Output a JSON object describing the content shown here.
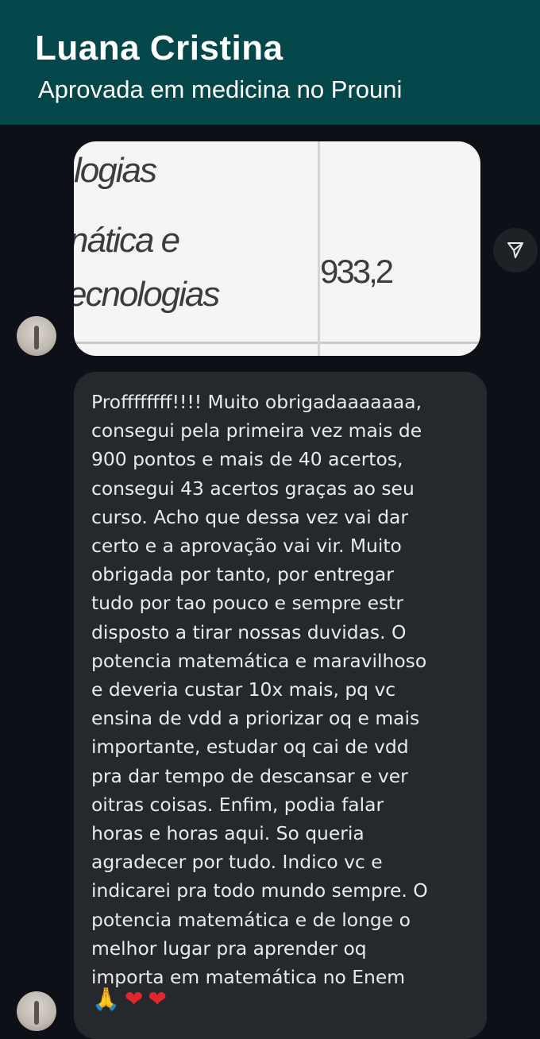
{
  "header": {
    "name": "Luana Cristina",
    "subtitle": "Aprovada em medicina no Prouni"
  },
  "image_message": {
    "cells": {
      "row1_left": "logias",
      "row2_left_line1": "nática e",
      "row2_left_line2": "ecnologias",
      "score": "933,2"
    }
  },
  "message": {
    "text": "Proffffffff!!!! Muito obrigadaaaaaaa,\nconsegui pela primeira vez mais de\n900 pontos e mais de 40 acertos,\nconsegui 43 acertos graças ao seu\ncurso. Acho que dessa vez vai dar\ncerto e a aprovação vai vir. Muito\nobrigada por tanto, por entregar\ntudo por tao pouco e sempre estr\ndisposto a tirar nossas duvidas. O\npotencia matemática e maravilhoso\ne deveria custar 10x mais, pq vc\nensina de vdd a priorizar oq e mais\nimportante, estudar oq cai de vdd\npra dar tempo de descansar e ver\noitras coisas. Enfim, podia falar\nhoras e horas aqui. So queria\nagradecer por tudo. Indico vc e\nindicarei pra todo mundo sempre. O\npotencia matemática e de longe o\nmelhor lugar pra aprender oq\nimporta em matemática no Enem",
    "emojis": [
      "🙏",
      "❤",
      "❤"
    ]
  },
  "icons": {
    "share": "share-icon",
    "avatar": "avatar"
  },
  "colors": {
    "header_bg": "#03474b",
    "chat_bg": "#0d1117",
    "bubble_bg": "#25282d",
    "heart": "#e3262e"
  }
}
